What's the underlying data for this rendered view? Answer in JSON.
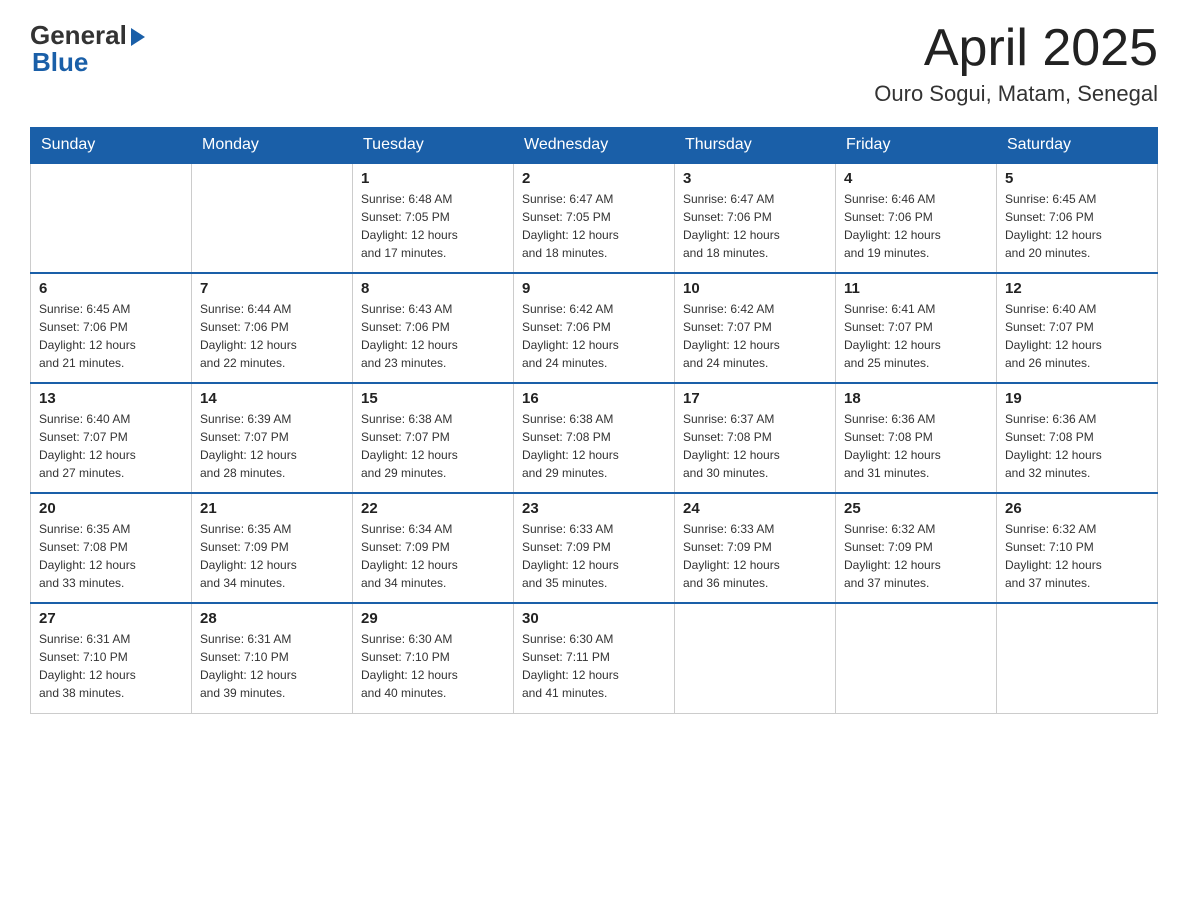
{
  "header": {
    "logo_general": "General",
    "logo_blue": "Blue",
    "month_title": "April 2025",
    "location": "Ouro Sogui, Matam, Senegal"
  },
  "days_of_week": [
    "Sunday",
    "Monday",
    "Tuesday",
    "Wednesday",
    "Thursday",
    "Friday",
    "Saturday"
  ],
  "weeks": [
    [
      {
        "day": "",
        "info": ""
      },
      {
        "day": "",
        "info": ""
      },
      {
        "day": "1",
        "info": "Sunrise: 6:48 AM\nSunset: 7:05 PM\nDaylight: 12 hours\nand 17 minutes."
      },
      {
        "day": "2",
        "info": "Sunrise: 6:47 AM\nSunset: 7:05 PM\nDaylight: 12 hours\nand 18 minutes."
      },
      {
        "day": "3",
        "info": "Sunrise: 6:47 AM\nSunset: 7:06 PM\nDaylight: 12 hours\nand 18 minutes."
      },
      {
        "day": "4",
        "info": "Sunrise: 6:46 AM\nSunset: 7:06 PM\nDaylight: 12 hours\nand 19 minutes."
      },
      {
        "day": "5",
        "info": "Sunrise: 6:45 AM\nSunset: 7:06 PM\nDaylight: 12 hours\nand 20 minutes."
      }
    ],
    [
      {
        "day": "6",
        "info": "Sunrise: 6:45 AM\nSunset: 7:06 PM\nDaylight: 12 hours\nand 21 minutes."
      },
      {
        "day": "7",
        "info": "Sunrise: 6:44 AM\nSunset: 7:06 PM\nDaylight: 12 hours\nand 22 minutes."
      },
      {
        "day": "8",
        "info": "Sunrise: 6:43 AM\nSunset: 7:06 PM\nDaylight: 12 hours\nand 23 minutes."
      },
      {
        "day": "9",
        "info": "Sunrise: 6:42 AM\nSunset: 7:06 PM\nDaylight: 12 hours\nand 24 minutes."
      },
      {
        "day": "10",
        "info": "Sunrise: 6:42 AM\nSunset: 7:07 PM\nDaylight: 12 hours\nand 24 minutes."
      },
      {
        "day": "11",
        "info": "Sunrise: 6:41 AM\nSunset: 7:07 PM\nDaylight: 12 hours\nand 25 minutes."
      },
      {
        "day": "12",
        "info": "Sunrise: 6:40 AM\nSunset: 7:07 PM\nDaylight: 12 hours\nand 26 minutes."
      }
    ],
    [
      {
        "day": "13",
        "info": "Sunrise: 6:40 AM\nSunset: 7:07 PM\nDaylight: 12 hours\nand 27 minutes."
      },
      {
        "day": "14",
        "info": "Sunrise: 6:39 AM\nSunset: 7:07 PM\nDaylight: 12 hours\nand 28 minutes."
      },
      {
        "day": "15",
        "info": "Sunrise: 6:38 AM\nSunset: 7:07 PM\nDaylight: 12 hours\nand 29 minutes."
      },
      {
        "day": "16",
        "info": "Sunrise: 6:38 AM\nSunset: 7:08 PM\nDaylight: 12 hours\nand 29 minutes."
      },
      {
        "day": "17",
        "info": "Sunrise: 6:37 AM\nSunset: 7:08 PM\nDaylight: 12 hours\nand 30 minutes."
      },
      {
        "day": "18",
        "info": "Sunrise: 6:36 AM\nSunset: 7:08 PM\nDaylight: 12 hours\nand 31 minutes."
      },
      {
        "day": "19",
        "info": "Sunrise: 6:36 AM\nSunset: 7:08 PM\nDaylight: 12 hours\nand 32 minutes."
      }
    ],
    [
      {
        "day": "20",
        "info": "Sunrise: 6:35 AM\nSunset: 7:08 PM\nDaylight: 12 hours\nand 33 minutes."
      },
      {
        "day": "21",
        "info": "Sunrise: 6:35 AM\nSunset: 7:09 PM\nDaylight: 12 hours\nand 34 minutes."
      },
      {
        "day": "22",
        "info": "Sunrise: 6:34 AM\nSunset: 7:09 PM\nDaylight: 12 hours\nand 34 minutes."
      },
      {
        "day": "23",
        "info": "Sunrise: 6:33 AM\nSunset: 7:09 PM\nDaylight: 12 hours\nand 35 minutes."
      },
      {
        "day": "24",
        "info": "Sunrise: 6:33 AM\nSunset: 7:09 PM\nDaylight: 12 hours\nand 36 minutes."
      },
      {
        "day": "25",
        "info": "Sunrise: 6:32 AM\nSunset: 7:09 PM\nDaylight: 12 hours\nand 37 minutes."
      },
      {
        "day": "26",
        "info": "Sunrise: 6:32 AM\nSunset: 7:10 PM\nDaylight: 12 hours\nand 37 minutes."
      }
    ],
    [
      {
        "day": "27",
        "info": "Sunrise: 6:31 AM\nSunset: 7:10 PM\nDaylight: 12 hours\nand 38 minutes."
      },
      {
        "day": "28",
        "info": "Sunrise: 6:31 AM\nSunset: 7:10 PM\nDaylight: 12 hours\nand 39 minutes."
      },
      {
        "day": "29",
        "info": "Sunrise: 6:30 AM\nSunset: 7:10 PM\nDaylight: 12 hours\nand 40 minutes."
      },
      {
        "day": "30",
        "info": "Sunrise: 6:30 AM\nSunset: 7:11 PM\nDaylight: 12 hours\nand 41 minutes."
      },
      {
        "day": "",
        "info": ""
      },
      {
        "day": "",
        "info": ""
      },
      {
        "day": "",
        "info": ""
      }
    ]
  ]
}
